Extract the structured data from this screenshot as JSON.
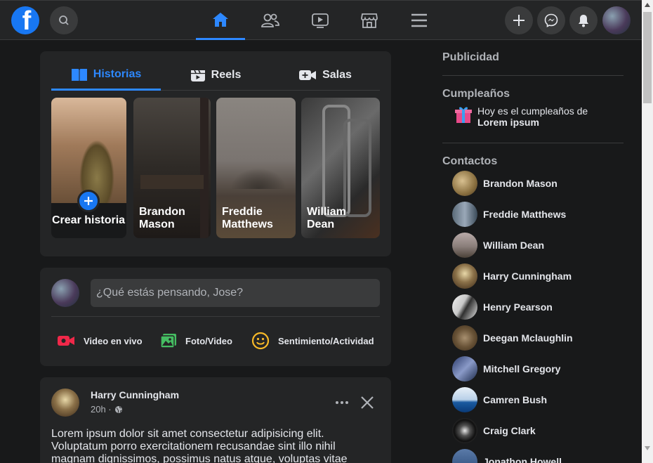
{
  "nav": {
    "logo_letter": "f",
    "tabs": [
      "home",
      "friends",
      "watch",
      "marketplace",
      "menu"
    ]
  },
  "stories": {
    "tabs": [
      {
        "label": "Historias"
      },
      {
        "label": "Reels"
      },
      {
        "label": "Salas"
      }
    ],
    "items": [
      {
        "name": "Crear historia"
      },
      {
        "name": "Brandon\nMason"
      },
      {
        "name": "Freddie\nMatthews"
      },
      {
        "name": "William\nDean"
      }
    ]
  },
  "composer": {
    "placeholder": "¿Qué estás pensando, Jose?",
    "actions": [
      {
        "label": "Video en vivo"
      },
      {
        "label": "Foto/Video"
      },
      {
        "label": "Sentimiento/Actividad"
      }
    ]
  },
  "post": {
    "author": "Harry Cunningham",
    "time": "20h ·",
    "text": "Lorem ipsum dolor sit amet consectetur adipisicing elit. Voluptatum porro exercitationem recusandae sint illo nihil magnam dignissimos, possimus natus atque, voluptas vitae"
  },
  "sidebar": {
    "ads_heading": "Publicidad",
    "birthdays_heading": "Cumpleaños",
    "birthday_line1": "Hoy es el cumpleaños de",
    "birthday_name": "Lorem ipsum",
    "contacts_heading": "Contactos",
    "contacts": [
      {
        "name": "Brandon Mason"
      },
      {
        "name": "Freddie Matthews"
      },
      {
        "name": "William Dean"
      },
      {
        "name": "Harry Cunningham"
      },
      {
        "name": "Henry Pearson"
      },
      {
        "name": "Deegan Mclaughlin"
      },
      {
        "name": "Mitchell Gregory"
      },
      {
        "name": "Camren Bush"
      },
      {
        "name": "Craig Clark"
      },
      {
        "name": "Jonathon Howell"
      }
    ]
  },
  "colors": {
    "accent": "#2d88ff",
    "background": "#18191a",
    "surface": "#242526"
  }
}
